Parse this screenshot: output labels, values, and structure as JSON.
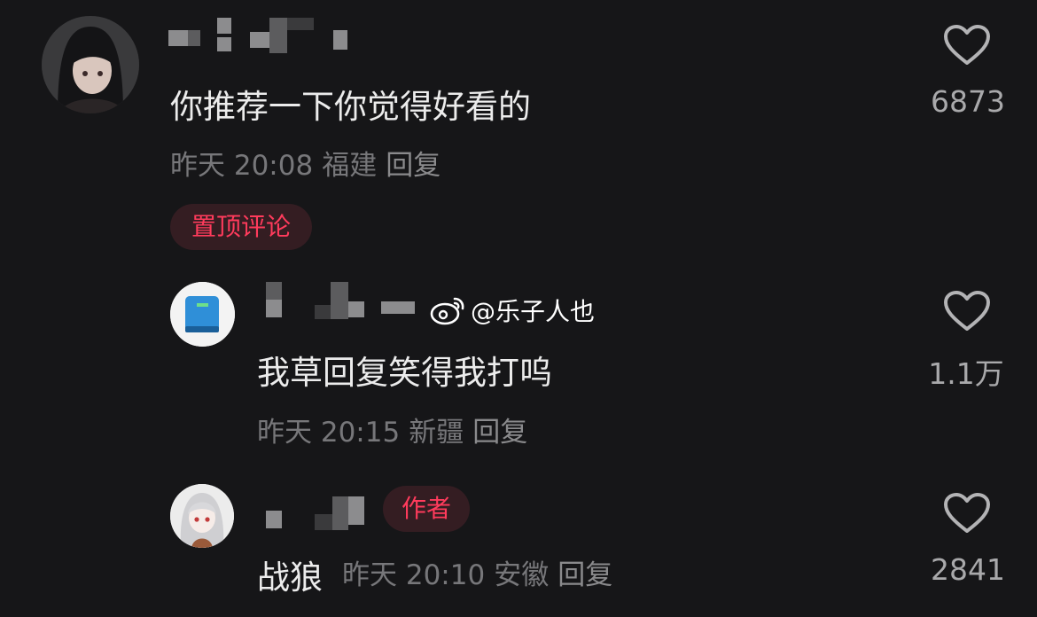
{
  "comments": [
    {
      "text": "你推荐一下你觉得好看的",
      "time": "昨天 20:08",
      "location": "福建",
      "reply": "回复",
      "badge": "置顶评论",
      "likes": "6873",
      "avatar": "dark-haired-girl-avatar"
    },
    {
      "text": "我草回复笑得我打呜",
      "time": "昨天 20:15",
      "location": "新疆",
      "reply": "回复",
      "likes": "1.1万",
      "avatar": "blue-book-avatar"
    },
    {
      "text": "战狼",
      "time": "昨天 20:10",
      "location": "安徽",
      "reply": "回复",
      "badge": "作者",
      "likes": "2841",
      "avatar": "white-haired-girl-avatar"
    }
  ],
  "watermark": {
    "text": "@乐子人也",
    "icon": "weibo-icon"
  },
  "colors": {
    "background": "#161618",
    "accent": "#ff3b5c",
    "muted": "#77777a"
  }
}
